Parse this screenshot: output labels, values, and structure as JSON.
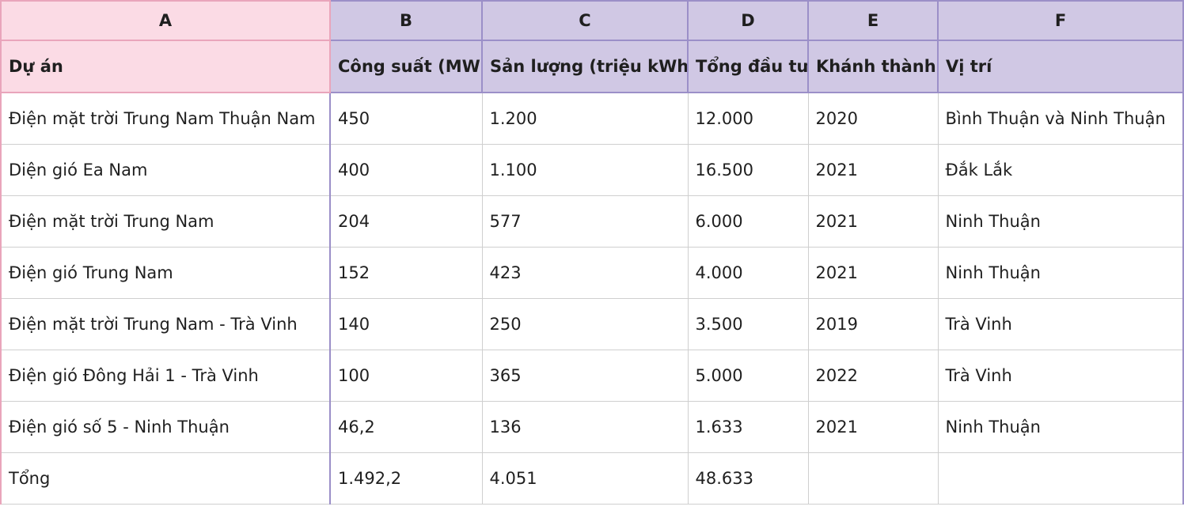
{
  "columns": [
    "A",
    "B",
    "C",
    "D",
    "E",
    "F"
  ],
  "headers": [
    "Dự án",
    "Công suất (MW)",
    "Sản lượng (triệu kWh)",
    "Tổng đầu tư",
    "Khánh thành",
    "Vị trí"
  ],
  "rows": [
    [
      "Điện mặt trời Trung Nam Thuận Nam",
      "450",
      "1.200",
      "12.000",
      "2020",
      "Bình Thuận và Ninh Thuận"
    ],
    [
      "Diện gió Ea Nam",
      "400",
      "1.100",
      "16.500",
      "2021",
      "Đắk Lắk"
    ],
    [
      "Điện mặt trời Trung Nam",
      "204",
      "577",
      "6.000",
      "2021",
      "Ninh Thuận"
    ],
    [
      "Điện gió Trung Nam",
      "152",
      "423",
      "4.000",
      "2021",
      "Ninh Thuận"
    ],
    [
      "Điện mặt trời Trung Nam - Trà Vinh",
      "140",
      "250",
      "3.500",
      "2019",
      "Trà Vinh"
    ],
    [
      "Điện gió Đông Hải 1 - Trà Vinh",
      "100",
      "365",
      "5.000",
      "2022",
      "Trà Vinh"
    ],
    [
      "Điện gió số 5 - Ninh Thuận",
      "46,2",
      "136",
      "1.633",
      "2021",
      "Ninh Thuận"
    ],
    [
      "Tổng",
      "1.492,2",
      "4.051",
      "48.633",
      "",
      ""
    ]
  ],
  "colors": {
    "header_purple": "#d0c8e4",
    "header_pink": "#fbdbe5",
    "border_purple": "#9b8fc8",
    "border_pink": "#e9a5bb"
  }
}
